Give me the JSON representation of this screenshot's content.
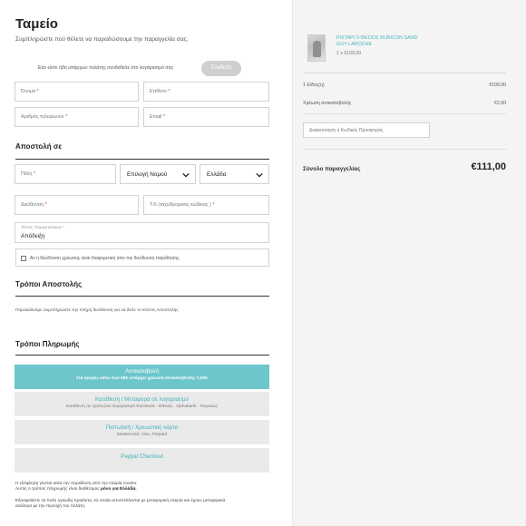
{
  "header": {
    "title": "Ταμείο",
    "subtitle": "Συμπληρώστε πού θέλετε να παραδώσουμε την παραγγελία σας."
  },
  "login": {
    "prompt": "Εάν είστε ήδη υπάρχων πελάτης συνδεθείτε στο λογαριασμό σας",
    "button_label": "Σύνδεση"
  },
  "contact": {
    "first_name": {
      "label": "Όνομα",
      "required": "*"
    },
    "last_name": {
      "label": "Επίθετο",
      "required": "*"
    },
    "phone": {
      "label": "Αριθμός τηλεφώνου",
      "required": "*"
    },
    "email": {
      "label": "Email",
      "required": "*"
    }
  },
  "shipping": {
    "title": "Αποστολή σε",
    "city": {
      "label": "Πόλη",
      "required": "*"
    },
    "region_select": "Επιλογή Νομού",
    "country_select": "Ελλάδα",
    "address": {
      "label": "Διεύθυνση",
      "required": "*"
    },
    "postcode": {
      "label": "Τ.Κ (ταχυδρομικός κώδικας )",
      "required": "*"
    },
    "invoice_type": {
      "label": "Τύπος Παραστατικού",
      "required": "*",
      "value": "Απόδειξη"
    },
    "different_billing": "Αν η διεύθυνση χρέωσης είναι διαφορετική απο την διεύθυνση παράδοσης"
  },
  "shipping_methods": {
    "title": "Τρόποι Αποστολής",
    "note": "Παρακαλούμε συμπληρώστε την πλήρη διεύθυνση για να δείτε το κόστος Αποστολής"
  },
  "payment": {
    "title": "Τρόποι Πληρωμής",
    "options": [
      {
        "name": "Αντικαταβολή",
        "detail": "Για αγορές κάτω των 59€ υπάρχει χρέωση αντικαταβολής 2,00€",
        "active": true
      },
      {
        "name": "Κατάθεση / Μεταφορά σε λογαριασμό",
        "detail": "Κατάθεση σε τραπεζικό λογαριασμό Eurobank - Εθνική - Alphabank - Πειραιώς",
        "active": false
      },
      {
        "name": "Πιστωτική / Χρεωστική κάρτα",
        "detail": "Mastercard, Visa, Prepaid",
        "active": false
      },
      {
        "name": "Paypal Checkout",
        "detail": "",
        "active": false
      }
    ],
    "note_line1": "Η εξόφληση γίνεται κατά την παράδοση από την εταιρία courier.",
    "note_line2_prefix": "Αυτός ο τρόπος πληρωμής είναι διαθέσιμος ",
    "note_line2_bold": "μόνο για Ελλάδα.",
    "note_para2_line1": "Εξασφαλίστε τα πολύ ογκώδη προϊόντα, τα οποία αποστέλλονται με μεταφορική εταιρία και έχουν μεταφορικά",
    "note_para2_line2": "ανάλογα με την περιοχή του πελάτη."
  },
  "order": {
    "product_name_line1": "ΡΙΧΤΑΡΙ 2-ΘΕΣΙΟΣ RUBICON SAND",
    "product_name_line2": "GUY LAROCHE",
    "product_qty": "1 x €109,00",
    "items_label": "1 Είδος(η)",
    "items_value": "€109,00",
    "cod_label": "Χρέωση αντικαταβολής",
    "cod_value": "€2,00",
    "coupon_placeholder": "Διαφοποίηση ή Κωδικός Προσφοράς",
    "total_label": "Σύνολο παραγγελίας",
    "total_value": "€111,00"
  },
  "colors": {
    "accent": "#6dc6cc",
    "link": "#4bb5bd",
    "panel_bg": "#f4f4f4"
  }
}
